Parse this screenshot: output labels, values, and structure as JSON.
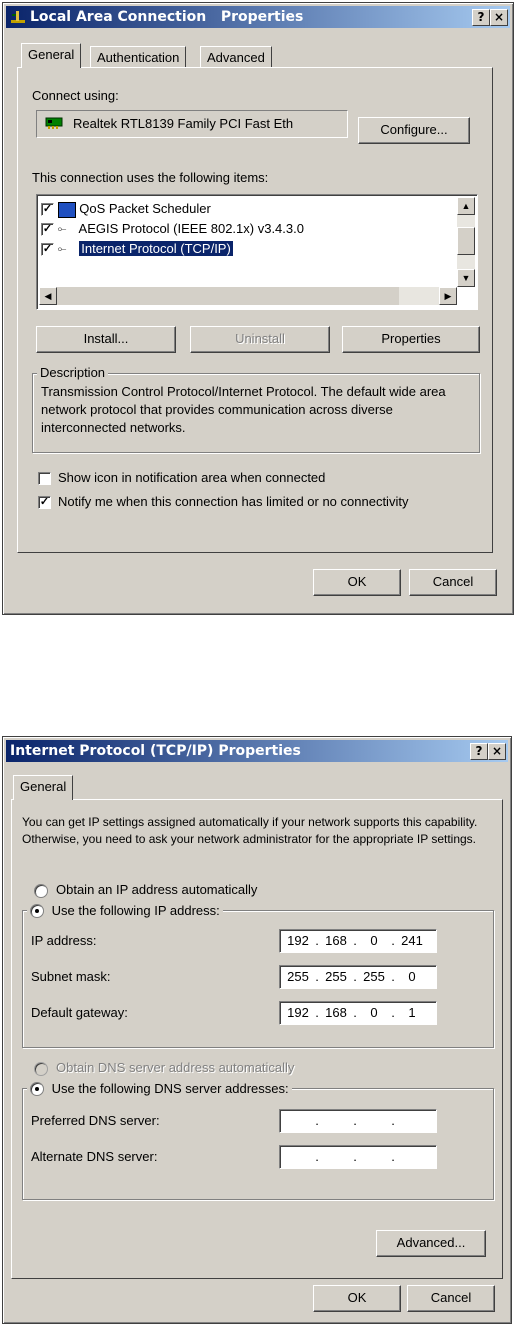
{
  "dialog1": {
    "title": "Local Area Connection   Properties",
    "help_button": "?",
    "close_button": "×",
    "tabs": [
      {
        "label": "General"
      },
      {
        "label": "Authentication"
      },
      {
        "label": "Advanced"
      }
    ],
    "connect_using_label": "Connect using:",
    "adapter_name": "Realtek RTL8139 Family PCI Fast Eth",
    "configure_button": "Configure...",
    "items_label": "This connection uses the following items:",
    "items": [
      {
        "label": "QoS Packet Scheduler",
        "checked": true
      },
      {
        "label": "AEGIS Protocol (IEEE 802.1x) v3.4.3.0",
        "checked": true
      },
      {
        "label": "Internet Protocol (TCP/IP)",
        "checked": true,
        "selected": true
      }
    ],
    "install_button": "Install...",
    "uninstall_button": "Uninstall",
    "properties_button": "Properties",
    "description_title": "Description",
    "description_text": "Transmission Control Protocol/Internet Protocol. The default wide area network protocol that provides communication across diverse interconnected networks.",
    "show_icon_label": "Show icon in notification area when connected",
    "show_icon_checked": false,
    "notify_label": "Notify me when this connection has limited or no connectivity",
    "notify_checked": true,
    "ok_button": "OK",
    "cancel_button": "Cancel"
  },
  "dialog2": {
    "title": "Internet Protocol (TCP/IP) Properties",
    "help_button": "?",
    "close_button": "×",
    "tab_label": "General",
    "intro_text": "You can get IP settings assigned automatically if your network supports this capability. Otherwise, you need to ask your network administrator for the appropriate IP settings.",
    "obtain_ip_label": "Obtain an IP address automatically",
    "use_ip_label": "Use the following IP address:",
    "ip_address_label": "IP address:",
    "ip_address": [
      "192",
      "168",
      "0",
      "241"
    ],
    "subnet_label": "Subnet mask:",
    "subnet_mask": [
      "255",
      "255",
      "255",
      "0"
    ],
    "gateway_label": "Default gateway:",
    "gateway": [
      "192",
      "168",
      "0",
      "1"
    ],
    "obtain_dns_label": "Obtain DNS server address automatically",
    "use_dns_label": "Use the following DNS server addresses:",
    "preferred_dns_label": "Preferred DNS server:",
    "alternate_dns_label": "Alternate DNS server:",
    "advanced_button": "Advanced...",
    "ok_button": "OK",
    "cancel_button": "Cancel"
  },
  "colors": {
    "titlebar_start": "#0a246a",
    "titlebar_end": "#a6caf0",
    "dialog_bg": "#d4d0c8",
    "selection": "#0a246a"
  }
}
